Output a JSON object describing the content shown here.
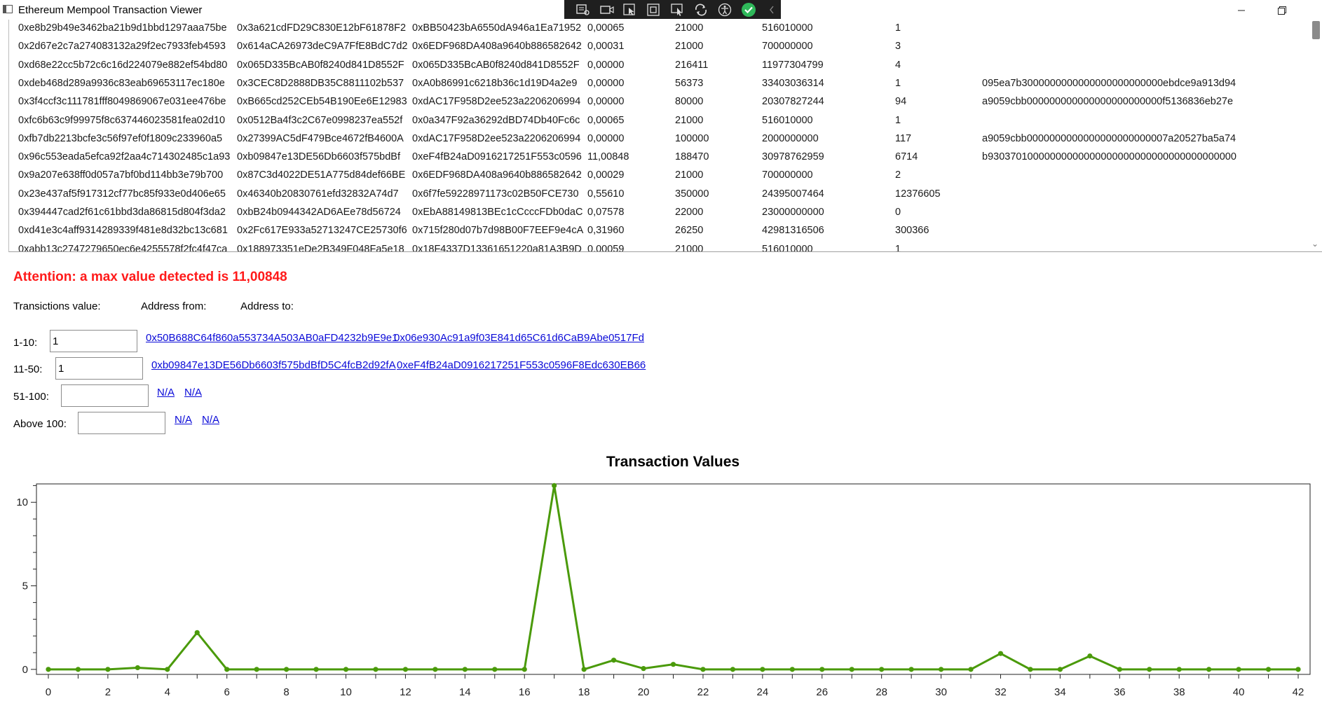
{
  "window": {
    "title": "Ethereum Mempool Transaction Viewer",
    "toolbar_icons": [
      "live-visual-tree-icon",
      "camera-icon",
      "select-element-icon",
      "display-layout-adorners-icon",
      "track-focused-element-icon",
      "hot-reload-icon",
      "accessibility-icon",
      "binding-check-icon",
      "collapse-toolbar-icon"
    ],
    "window_buttons": [
      "minimize-icon",
      "restore-icon"
    ]
  },
  "transactions": [
    {
      "hash": "0xe8b29b49e3462ba21b9d1bbd1297aaa75be",
      "from": "0x3a621cdFD29C830E12bF61878F2",
      "to": "0xBB50423bA6550dA946a1Ea71952",
      "value": "0,00065",
      "gas": "21000",
      "gas_price": "516010000",
      "nonce": "1",
      "input": ""
    },
    {
      "hash": "0x2d67e2c7a274083132a29f2ec7933feb4593",
      "from": "0x614aCA26973deC9A7FfE8BdC7d2",
      "to": "0x6EDF968DA408a9640b886582642",
      "value": "0,00031",
      "gas": "21000",
      "gas_price": "700000000",
      "nonce": "3",
      "input": ""
    },
    {
      "hash": "0xd68e22cc5b72c6c16d224079e882ef54bd80",
      "from": "0x065D335BcAB0f8240d841D8552F",
      "to": "0x065D335BcAB0f8240d841D8552F",
      "value": "0,00000",
      "gas": "216411",
      "gas_price": "11977304799",
      "nonce": "4",
      "input": ""
    },
    {
      "hash": "0xdeb468d289a9936c83eab69653117ec180e",
      "from": "0x3CEC8D2888DB35C8811102b537",
      "to": "0xA0b86991c6218b36c1d19D4a2e9",
      "value": "0,00000",
      "gas": "56373",
      "gas_price": "33403036314",
      "nonce": "1",
      "input": "095ea7b3000000000000000000000000ebdce9a913d94"
    },
    {
      "hash": "0x3f4ccf3c111781fff8049869067e031ee476be",
      "from": "0xB665cd252CEb54B190Ee6E12983",
      "to": "0xdAC17F958D2ee523a2206206994",
      "value": "0,00000",
      "gas": "80000",
      "gas_price": "20307827244",
      "nonce": "94",
      "input": "a9059cbb000000000000000000000000f5136836eb27e"
    },
    {
      "hash": "0xfc6b63c9f99975f8c637446023581fea02d10",
      "from": "0x0512Ba4f3c2C67e0998237ea552f",
      "to": "0x0a347F92a36292dBD74Db40Fc6c",
      "value": "0,00065",
      "gas": "21000",
      "gas_price": "516010000",
      "nonce": "1",
      "input": ""
    },
    {
      "hash": "0xfb7db2213bcfe3c56f97ef0f1809c233960a5",
      "from": "0x27399AC5dF479Bce4672fB4600A",
      "to": "0xdAC17F958D2ee523a2206206994",
      "value": "0,00000",
      "gas": "100000",
      "gas_price": "2000000000",
      "nonce": "117",
      "input": "a9059cbb0000000000000000000000007a20527ba5a74"
    },
    {
      "hash": "0x96c553eada5efca92f2aa4c714302485c1a93",
      "from": "0xb09847e13DE56Db6603f575bdBf",
      "to": "0xeF4fB24aD0916217251F553c0596",
      "value": "11,00848",
      "gas": "188470",
      "gas_price": "30978762959",
      "nonce": "6714",
      "input": "b93037010000000000000000000000000000000000000"
    },
    {
      "hash": "0x9a207e638ff0d057a7bf0bd114bb3e79b700",
      "from": "0x87C3d4022DE51A775d84def66BE",
      "to": "0x6EDF968DA408a9640b886582642",
      "value": "0,00029",
      "gas": "21000",
      "gas_price": "700000000",
      "nonce": "2",
      "input": ""
    },
    {
      "hash": "0x23e437af5f917312cf77bc85f933e0d406e65",
      "from": "0x46340b20830761efd32832A74d7",
      "to": "0x6f7fe59228971173c02B50FCE730",
      "value": "0,55610",
      "gas": "350000",
      "gas_price": "24395007464",
      "nonce": "12376605",
      "input": ""
    },
    {
      "hash": "0x394447cad2f61c61bbd3da86815d804f3da2",
      "from": "0xbB24b0944342AD6AEe78d56724",
      "to": "0xEbA88149813BEc1cCcccFDb0daC",
      "value": "0,07578",
      "gas": "22000",
      "gas_price": "23000000000",
      "nonce": "0",
      "input": ""
    },
    {
      "hash": "0xd41e3c4aff9314289339f481e8d32bc13c681",
      "from": "0x2Fc617E933a52713247CE25730f6",
      "to": "0x715f280d07b7d98B00F7EEF9e4cA",
      "value": "0,31960",
      "gas": "26250",
      "gas_price": "42981316506",
      "nonce": "300366",
      "input": ""
    },
    {
      "hash": "0xabb13c2747279650ec6e4255578f2fc4f47ca",
      "from": "0x188973351eDe2B349F048Fa5e18",
      "to": "0x18F4337D13361651220a81A3B9D",
      "value": "0,00059",
      "gas": "21000",
      "gas_price": "516010000",
      "nonce": "1",
      "input": ""
    }
  ],
  "attention_text": "Attention: a max value detected is 11,00848",
  "headers": {
    "value": "Transictions value:",
    "from": "Address from:",
    "to": "Address to:"
  },
  "ranges": [
    {
      "label": "1-10:",
      "count": "1",
      "from": "0x50B688C64f860a553734A503AB0aFD4232b9E9e1",
      "to": "0x06e930Ac91a9f03E841d65C61d6CaB9Abe0517Fd"
    },
    {
      "label": "11-50:",
      "count": "1",
      "from": "0xb09847e13DE56Db6603f575bdBfD5C4fcB2d92fA",
      "to": "0xeF4fB24aD0916217251F553c0596F8Edc630EB66"
    },
    {
      "label": "51-100:",
      "count": "",
      "from": "N/A",
      "to": "N/A"
    },
    {
      "label": "Above 100:",
      "count": "",
      "from": "N/A",
      "to": "N/A"
    }
  ],
  "chart_data": {
    "type": "line",
    "title": "Transaction Values",
    "xlabel": "",
    "ylabel": "",
    "x": [
      0,
      1,
      2,
      3,
      4,
      5,
      6,
      7,
      8,
      9,
      10,
      11,
      12,
      13,
      14,
      15,
      16,
      17,
      18,
      19,
      20,
      21,
      22,
      23,
      24,
      25,
      26,
      27,
      28,
      29,
      30,
      31,
      32,
      33,
      34,
      35,
      36,
      37,
      38,
      39,
      40,
      41,
      42
    ],
    "series": [
      {
        "values": [
          0,
          0,
          0,
          0.1,
          0,
          2.2,
          0,
          0,
          0,
          0,
          0,
          0,
          0,
          0,
          0,
          0,
          0,
          11.0,
          0,
          0.55,
          0.05,
          0.3,
          0,
          0,
          0,
          0,
          0,
          0,
          0,
          0,
          0,
          0,
          0.95,
          0,
          0,
          0.8,
          0,
          0,
          0,
          0,
          0,
          0,
          0
        ]
      }
    ],
    "xlim": [
      -0.4,
      42.4
    ],
    "ylim": [
      -0.3,
      11.1
    ],
    "x_ticks": [
      0,
      2,
      4,
      6,
      8,
      10,
      12,
      14,
      16,
      18,
      20,
      22,
      24,
      26,
      28,
      30,
      32,
      34,
      36,
      38,
      40,
      42
    ],
    "y_ticks": [
      0,
      5,
      10
    ],
    "grid": false,
    "legend": "none",
    "color": "#4a9a0a"
  }
}
